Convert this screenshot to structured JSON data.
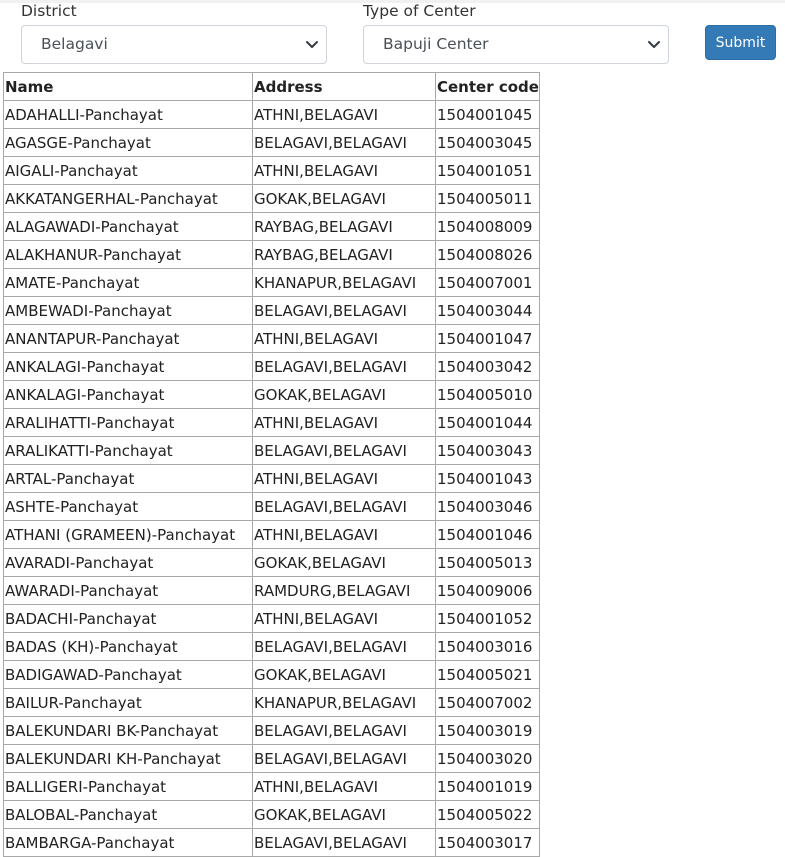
{
  "filters": {
    "district_label": "District",
    "district_value": "Belagavi",
    "type_label": "Type of Center",
    "type_value": "Bapuji Center",
    "submit_label": "Submit"
  },
  "table": {
    "headers": [
      "Name",
      "Address",
      "Center code"
    ],
    "rows": [
      [
        "ADAHALLI-Panchayat",
        "ATHNI,BELAGAVI",
        "1504001045"
      ],
      [
        "AGASGE-Panchayat",
        "BELAGAVI,BELAGAVI",
        "1504003045"
      ],
      [
        "AIGALI-Panchayat",
        "ATHNI,BELAGAVI",
        "1504001051"
      ],
      [
        "AKKATANGERHAL-Panchayat",
        "GOKAK,BELAGAVI",
        "1504005011"
      ],
      [
        "ALAGAWADI-Panchayat",
        "RAYBAG,BELAGAVI",
        "1504008009"
      ],
      [
        "ALAKHANUR-Panchayat",
        "RAYBAG,BELAGAVI",
        "1504008026"
      ],
      [
        "AMATE-Panchayat",
        "KHANAPUR,BELAGAVI",
        "1504007001"
      ],
      [
        "AMBEWADI-Panchayat",
        "BELAGAVI,BELAGAVI",
        "1504003044"
      ],
      [
        "ANANTAPUR-Panchayat",
        "ATHNI,BELAGAVI",
        "1504001047"
      ],
      [
        "ANKALAGI-Panchayat",
        "BELAGAVI,BELAGAVI",
        "1504003042"
      ],
      [
        "ANKALAGI-Panchayat",
        "GOKAK,BELAGAVI",
        "1504005010"
      ],
      [
        "ARALIHATTI-Panchayat",
        "ATHNI,BELAGAVI",
        "1504001044"
      ],
      [
        "ARALIKATTI-Panchayat",
        "BELAGAVI,BELAGAVI",
        "1504003043"
      ],
      [
        "ARTAL-Panchayat",
        "ATHNI,BELAGAVI",
        "1504001043"
      ],
      [
        "ASHTE-Panchayat",
        "BELAGAVI,BELAGAVI",
        "1504003046"
      ],
      [
        "ATHANI (GRAMEEN)-Panchayat",
        "ATHNI,BELAGAVI",
        "1504001046"
      ],
      [
        "AVARADI-Panchayat",
        "GOKAK,BELAGAVI",
        "1504005013"
      ],
      [
        "AWARADI-Panchayat",
        "RAMDURG,BELAGAVI",
        "1504009006"
      ],
      [
        "BADACHI-Panchayat",
        "ATHNI,BELAGAVI",
        "1504001052"
      ],
      [
        "BADAS (KH)-Panchayat",
        "BELAGAVI,BELAGAVI",
        "1504003016"
      ],
      [
        "BADIGAWAD-Panchayat",
        "GOKAK,BELAGAVI",
        "1504005021"
      ],
      [
        "BAILUR-Panchayat",
        "KHANAPUR,BELAGAVI",
        "1504007002"
      ],
      [
        "BALEKUNDARI BK-Panchayat",
        "BELAGAVI,BELAGAVI",
        "1504003019"
      ],
      [
        "BALEKUNDARI KH-Panchayat",
        "BELAGAVI,BELAGAVI",
        "1504003020"
      ],
      [
        "BALLIGERI-Panchayat",
        "ATHNI,BELAGAVI",
        "1504001019"
      ],
      [
        "BALOBAL-Panchayat",
        "GOKAK,BELAGAVI",
        "1504005022"
      ],
      [
        "BAMBARGA-Panchayat",
        "BELAGAVI,BELAGAVI",
        "1504003017"
      ]
    ]
  },
  "icons": {
    "select_arrow": "chevron-down-icon"
  },
  "colors": {
    "submit_bg": "#337ab7",
    "border": "#a8a8a8"
  }
}
